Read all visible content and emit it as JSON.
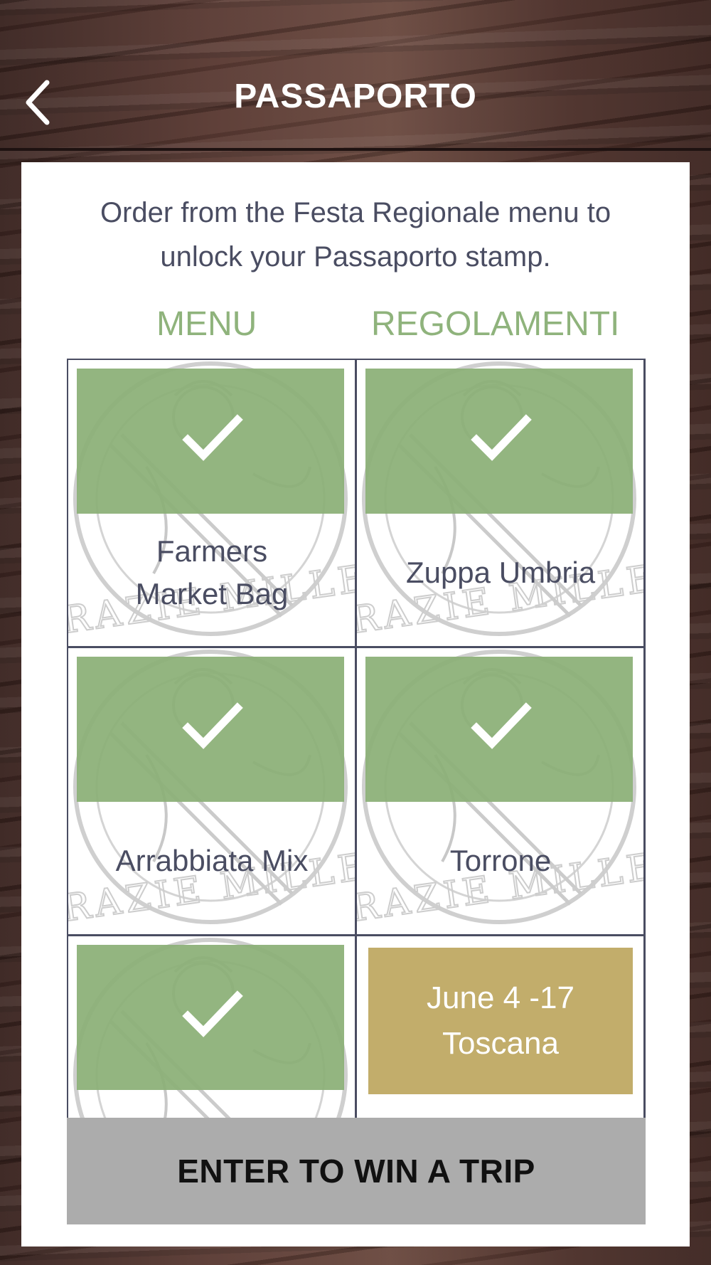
{
  "nav": {
    "title": "PASSAPORTO",
    "back_icon": "chevron-left-icon"
  },
  "intro": {
    "line1": "Order from the Festa Regionale menu to",
    "line2": "unlock your Passaporto stamp."
  },
  "tabs": [
    {
      "label": "MENU",
      "color": "#8fb37c"
    },
    {
      "label": "REGOLAMENTI",
      "color": "#8fb37c"
    }
  ],
  "stamp": {
    "watermark_text": "GRAZIE MILLE!",
    "check_icon": "checkmark-icon",
    "check_color": "#8baf76"
  },
  "items": [
    {
      "line1": "Farmers",
      "line2": "Market Bag",
      "completed": true
    },
    {
      "line1": "Zuppa Umbria",
      "line2": "",
      "completed": true
    },
    {
      "line1": "Arrabbiata Mix",
      "line2": "",
      "completed": true
    },
    {
      "line1": "Torrone",
      "line2": "",
      "completed": true
    },
    {
      "line1": "",
      "line2": "",
      "completed": true
    }
  ],
  "event": {
    "dates": "June 4 -17",
    "region": "Toscana",
    "color": "#c2ad6b"
  },
  "cta": {
    "label": "ENTER TO WIN A TRIP"
  }
}
